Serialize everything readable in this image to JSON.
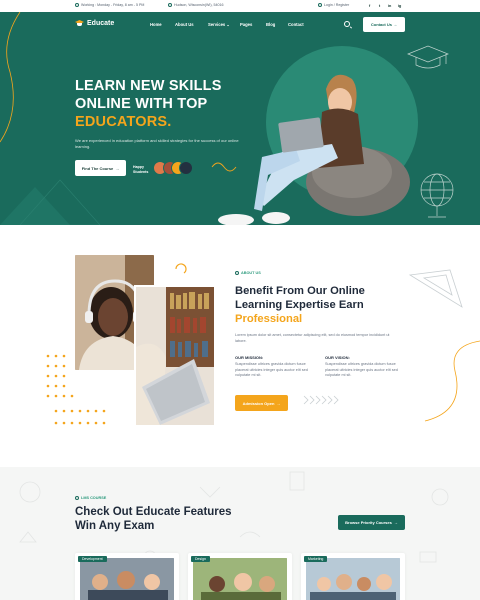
{
  "topbar": {
    "hours": "Working : Monday - Friday, 8 am - 5 PM",
    "address": "Hudson, Wisconsin(WI), 54016",
    "login": "Login / Register",
    "social": [
      "f",
      "t",
      "in",
      "ig"
    ]
  },
  "nav": {
    "brand": "Educate",
    "items": [
      "Home",
      "About Us",
      "Services",
      "Pages",
      "Blog",
      "Contact"
    ],
    "contact_button": "Contact Us"
  },
  "hero": {
    "line1": "LEARN NEW SKILLS",
    "line2": "ONLINE WITH TOP",
    "line3": "EDUCATORS.",
    "text": "We are experienced in education platform and skilled strategies for the success of our online learning.",
    "cta": "Find The Course",
    "students_label_1": "Happy",
    "students_label_2": "Students"
  },
  "about": {
    "tag": "ABOUT US",
    "title_1": "Benefit From Our Online",
    "title_2": "Learning Expertise Earn",
    "title_3": "Professional",
    "intro": "Lorem ipsum dolor sit amet, consectetur adipiscing elit, sed do eiusmod tempor incididunt ut labore.",
    "mission_title": "OUR MISSION:",
    "mission_text": "Suspendisse ultrices gravida dictum fusce placerat ultricies integer quis auctor elit sed vulputate mi sit.",
    "vision_title": "OUR VISION:",
    "vision_text": "Suspendisse ultrices gravida dictum fusce placerat ultricies integer quis auctor elit sed vulputate mi sit.",
    "cta": "Admission Open"
  },
  "features": {
    "tag": "LMS COURSE",
    "title_1": "Check Out Educate Features",
    "title_2": "Win Any Exam",
    "cta": "Browse Priority Courses",
    "cards": [
      {
        "tag": "Development"
      },
      {
        "tag": "Design"
      },
      {
        "tag": "Marketing"
      }
    ]
  },
  "colors": {
    "primary": "#1a6b5c",
    "accent": "#f4a51c",
    "text_dark": "#1f2a3a"
  }
}
